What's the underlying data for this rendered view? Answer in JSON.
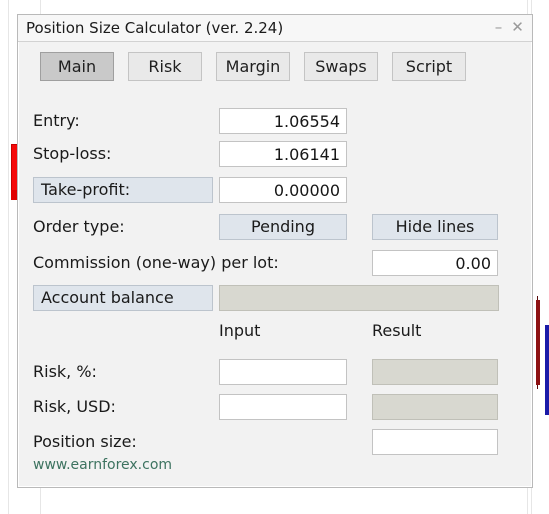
{
  "window": {
    "title": "Position Size Calculator (ver. 2.24)",
    "minimize_icon": "minimize-icon",
    "minimize_glyph": "–",
    "close_icon": "close-icon",
    "close_glyph": "✕"
  },
  "tabs": [
    {
      "label": "Main",
      "active": true
    },
    {
      "label": "Risk",
      "active": false
    },
    {
      "label": "Margin",
      "active": false
    },
    {
      "label": "Swaps",
      "active": false
    },
    {
      "label": "Script",
      "active": false
    }
  ],
  "form": {
    "entry": {
      "label": "Entry:",
      "value": "1.06554"
    },
    "stop_loss": {
      "label": "Stop-loss:",
      "value": "1.06141"
    },
    "take_profit": {
      "label": "Take-profit:",
      "value": "0.00000"
    },
    "order_type": {
      "label": "Order type:",
      "button": "Pending"
    },
    "hide_lines": {
      "label": "Hide lines"
    },
    "commission": {
      "label": "Commission (one-way) per lot:",
      "value": "0.00"
    },
    "account_balance": {
      "label": "Account balance",
      "value": ""
    }
  },
  "columns": {
    "input": "Input",
    "result": "Result"
  },
  "results": [
    {
      "label": "Risk, %:",
      "input": "",
      "result": ""
    },
    {
      "label": "Risk, USD:",
      "input": "",
      "result": ""
    }
  ],
  "position_size": {
    "label": "Position size:",
    "value": ""
  },
  "footer": {
    "link": "www.earnforex.com"
  },
  "colors": {
    "panel_bg": "#f2f2f2",
    "titlebar_bg": "#f7f7f7",
    "tab_bg": "#e9e9e9",
    "tab_active_bg": "#c9c9c9",
    "button_bg": "#dfe5ec",
    "field_bg": "#ffffff",
    "field_readonly_bg": "#d8d8d0",
    "label_text": "#1a1a1a",
    "link_text": "#3d7360",
    "candle_bull_red": "#f50a0a",
    "candle_dark_red": "#8d1113",
    "line_blue": "#1a1aa8"
  }
}
